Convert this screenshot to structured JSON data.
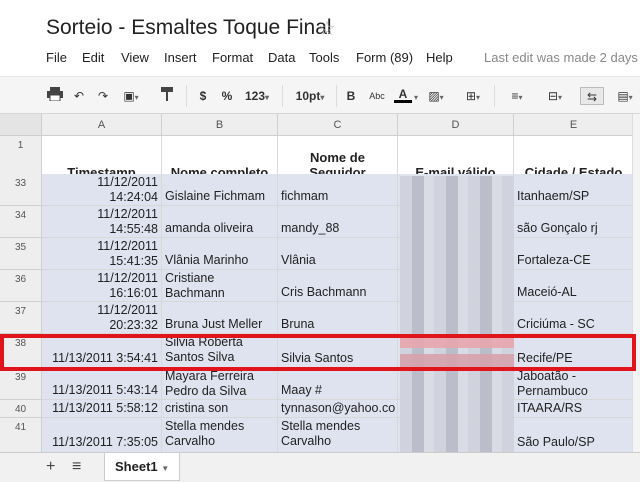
{
  "document": {
    "title": "Sorteio - Esmaltes Toque Final",
    "star_icon": "star-outline-icon"
  },
  "menu": {
    "items": [
      "File",
      "Edit",
      "View",
      "Insert",
      "Format",
      "Data",
      "Tools",
      "Form (89)",
      "Help"
    ],
    "last_edit": "Last edit was made 2 days"
  },
  "toolbar": {
    "number_format": "123",
    "font_size": "10pt",
    "bold": "B",
    "strikethrough": "Abc",
    "text_color": "A",
    "currency": "$",
    "percent": "%"
  },
  "columns": [
    "A",
    "B",
    "C",
    "D",
    "E"
  ],
  "header_row": {
    "number": "1",
    "cells": [
      "Timestamp",
      "Nome completo",
      "Nome de\nSeguidor",
      "E-mail válido",
      "Cidade / Estado"
    ]
  },
  "rows": [
    {
      "number": "33",
      "timestamp": "11/12/2011\n14:24:04",
      "nome": "Gislaine Fichmam",
      "seguidor": "fichmam",
      "email": "",
      "cidade": "Itanhaem/SP"
    },
    {
      "number": "34",
      "timestamp": "11/12/2011\n14:55:48",
      "nome": "amanda oliveira",
      "seguidor": "mandy_88",
      "email": "",
      "cidade": "são Gonçalo rj"
    },
    {
      "number": "35",
      "timestamp": "11/12/2011\n15:41:35",
      "nome": "Vlânia Marinho",
      "seguidor": "Vlânia",
      "email": "",
      "cidade": "Fortaleza-CE"
    },
    {
      "number": "36",
      "timestamp": "11/12/2011\n16:16:01",
      "nome": "Cristiane\nBachmann",
      "seguidor": "Cris Bachmann",
      "email": "",
      "cidade": "Maceió-AL"
    },
    {
      "number": "37",
      "timestamp": "11/12/2011\n20:23:32",
      "nome": "Bruna Just Meller",
      "seguidor": "Bruna",
      "email": "",
      "cidade": "Criciúma - SC"
    },
    {
      "number": "38",
      "timestamp": "11/13/2011 3:54:41",
      "nome": "Silvia Roberta\nSantos Silva",
      "seguidor": "Silvia Santos",
      "email": "",
      "cidade": "Recife/PE"
    },
    {
      "number": "39",
      "timestamp": "11/13/2011 5:43:14",
      "nome": "Mayara Ferreira\nPedro da Silva",
      "seguidor": "Maay #",
      "email": "",
      "cidade": "Jaboatão -\nPernambuco"
    },
    {
      "number": "40",
      "timestamp": "11/13/2011 5:58:12",
      "nome": "cristina son",
      "seguidor": "tynnason@yahoo.co",
      "email": "",
      "cidade": "ITAARA/RS"
    },
    {
      "number": "41",
      "timestamp": "11/13/2011 7:35:05",
      "nome": "Stella mendes\nCarvalho",
      "seguidor": "Stella mendes\nCarvalho",
      "email": "",
      "cidade": "São Paulo/SP"
    }
  ],
  "footer": {
    "add_icon": "plus-icon",
    "list_icon": "sheet-list-icon",
    "sheet_tab": "Sheet1"
  },
  "colors": {
    "highlight": "#e0141b",
    "cell_bg": "#dfe3ef"
  }
}
